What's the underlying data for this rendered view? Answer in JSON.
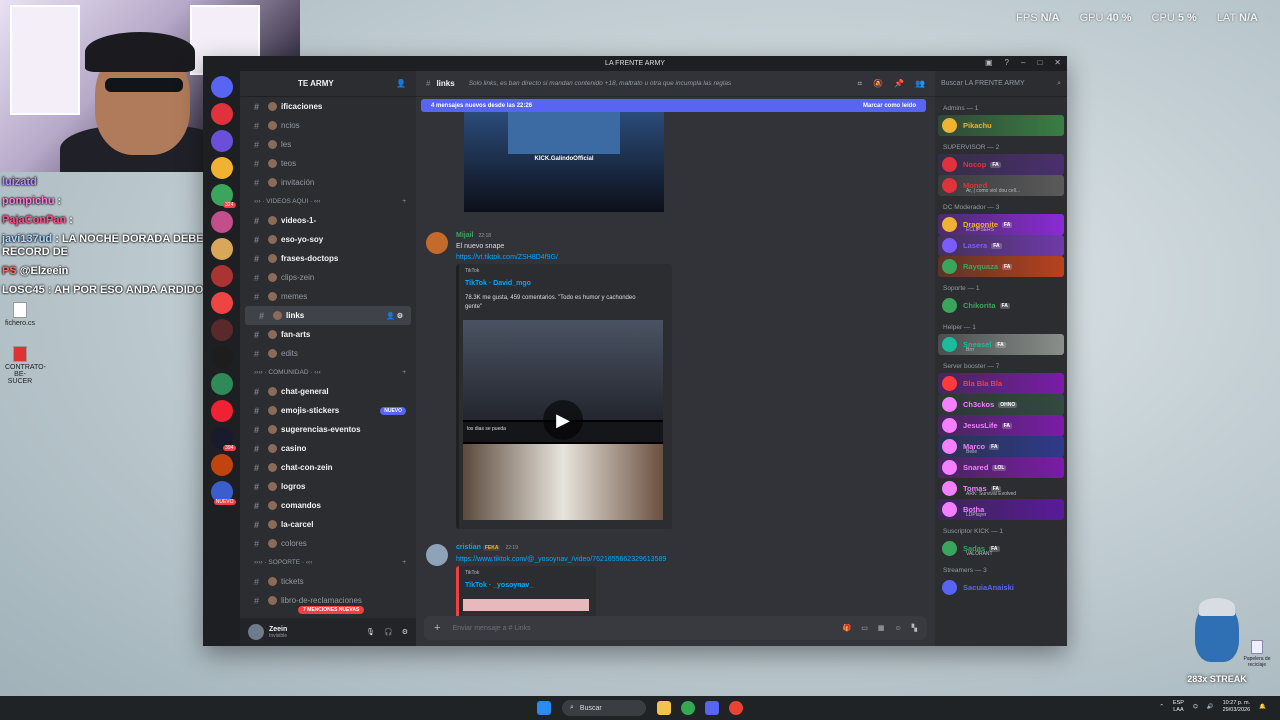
{
  "hud": {
    "fps_label": "FPS",
    "fps": "N/A",
    "gpu_label": "GPU",
    "gpu": "40 %",
    "cpu_label": "CPU",
    "cpu": "5 %",
    "lat_label": "LAT",
    "lat": "N/A"
  },
  "chat_overlay": [
    {
      "user": "luizatd",
      "text": ""
    },
    {
      "user": "pompichu",
      "text": ":"
    },
    {
      "user": "PajaConPan",
      "text": ":"
    },
    {
      "user": "javi137ud",
      "text": ": LA NOCHE DORADA DEBE ROMPER RECORD DE"
    },
    {
      "user": "PS",
      "text": "@Elzeein"
    },
    {
      "user": "LOSC45",
      "text": ": AH POR ESO ANDA ARDIDO XD"
    }
  ],
  "desktop_icons": [
    {
      "label": "fichero.cs",
      "type": "file"
    },
    {
      "label": "CONTRATO-BE-SUCER",
      "type": "pdf"
    }
  ],
  "window": {
    "title": "LA FRENTE ARMY",
    "server_name": "TE ARMY"
  },
  "guild_badges": [
    "324",
    "394"
  ],
  "guild_new": "NUEVO",
  "channels": [
    {
      "kind": "chan",
      "name": "ificaciones",
      "style": "bright"
    },
    {
      "kind": "chan",
      "name": "ncios"
    },
    {
      "kind": "chan",
      "name": "les"
    },
    {
      "kind": "chan",
      "name": "teos"
    },
    {
      "kind": "chan",
      "name": "invitación"
    },
    {
      "kind": "cat",
      "name": "››› · VIDEOS AQUI · ‹‹‹"
    },
    {
      "kind": "chan",
      "name": "videos-1-",
      "style": "bright"
    },
    {
      "kind": "chan",
      "name": "eso-yo-soy",
      "style": "bright"
    },
    {
      "kind": "chan",
      "name": "frases-doctops",
      "style": "bright"
    },
    {
      "kind": "chan",
      "name": "clips-zein"
    },
    {
      "kind": "chan",
      "name": "memes"
    },
    {
      "kind": "chan",
      "name": "links",
      "style": "sel"
    },
    {
      "kind": "chan",
      "name": "fan-arts",
      "style": "bright"
    },
    {
      "kind": "chan",
      "name": "edits"
    },
    {
      "kind": "cat",
      "name": "›››› · COMUNIDAD · ‹‹‹"
    },
    {
      "kind": "chan",
      "name": "chat-general",
      "style": "bright"
    },
    {
      "kind": "chan",
      "name": "emojis-stickers",
      "style": "bright",
      "badge": "NUEVO"
    },
    {
      "kind": "chan",
      "name": "sugerencias-eventos",
      "style": "bright"
    },
    {
      "kind": "chan",
      "name": "casino",
      "style": "bright"
    },
    {
      "kind": "chan",
      "name": "chat-con-zein",
      "style": "bright"
    },
    {
      "kind": "chan",
      "name": "logros",
      "style": "bright"
    },
    {
      "kind": "chan",
      "name": "comandos",
      "style": "bright"
    },
    {
      "kind": "chan",
      "name": "la-carcel",
      "style": "bright"
    },
    {
      "kind": "chan",
      "name": "colores"
    },
    {
      "kind": "cat",
      "name": "›››› · SOPORTE · ‹‹‹"
    },
    {
      "kind": "chan",
      "name": "tickets"
    },
    {
      "kind": "chan",
      "name": "libro-de-reclamaciones"
    }
  ],
  "mentions_pill": "7 MENCIONES NUEVAS",
  "user_panel": {
    "name": "Zeein",
    "status": "Invisible"
  },
  "header": {
    "channel": "links",
    "topic": "Solo links, es ban directo si mandan contenido +18, maltrato u otra que incumpla las reglas"
  },
  "new_messages": {
    "text": "4 mensajes nuevos desde las 22:26",
    "action": "Marcar como leído"
  },
  "messages": {
    "first_caption": "KICK.GalindoOfficial",
    "m1": {
      "author": "Mijail",
      "time": "22:18",
      "text": "El nuevo snape",
      "link": "https://vt.tiktok.com/ZSH8D4f9G/",
      "provider": "TikTok",
      "embed_title": "TikTok · David_mgo",
      "embed_desc_1": "78.3K me gusta, 459 comentarios. \"Todo es humor y cachondeo",
      "embed_desc_2": "gente\"",
      "video_caption": "los dias se pueda"
    },
    "m2": {
      "author": "cristian",
      "tag": "FEKA",
      "time": "22:19",
      "link": "https://www.tiktok.com/@_yosoynav_/video/7621655662329613589",
      "provider": "TikTok",
      "embed_title": "TikTok · _yosoynav_"
    }
  },
  "composer": {
    "placeholder": "Enviar mensaje a #",
    "channel": "Links"
  },
  "members": {
    "search": "Buscar LA FRENTE ARMY",
    "groups": [
      {
        "role": "Admins — 1",
        "list": [
          {
            "name": "Pikachu",
            "color": "#f0b232",
            "bg": "#3a7d44",
            "tag": ""
          }
        ]
      },
      {
        "role": "SUPERVISOR — 2",
        "list": [
          {
            "name": "Nocop",
            "color": "#e0323c",
            "bg": "#4a2f6e",
            "tag": "FA"
          },
          {
            "name": "Moned",
            "color": "#e0323c",
            "bg": "#5a5a5a",
            "tag": "",
            "status": "Ar, | como viol dou cell..."
          }
        ]
      },
      {
        "role": "DC Moderador — 3",
        "list": [
          {
            "name": "Dragonite",
            "color": "#f0b232",
            "bg": "#8a2bd6",
            "tag": "FA",
            "status": "ECLIPSERS"
          },
          {
            "name": "Lasera",
            "color": "#7c5cff",
            "bg": "#6f3aa8",
            "tag": "FA"
          },
          {
            "name": "Rayquaza",
            "color": "#3ba55d",
            "bg": "#b8421e",
            "tag": "FA"
          }
        ]
      },
      {
        "role": "Soporte — 1",
        "list": [
          {
            "name": "Chikorita",
            "color": "#3ba55d",
            "bg": "",
            "tag": "FA"
          }
        ]
      },
      {
        "role": "Helper — 1",
        "list": [
          {
            "name": "Sneasel",
            "color": "#1abc9c",
            "bg": "#8a8f8a",
            "tag": "FA",
            "status": "Brrr"
          }
        ]
      },
      {
        "role": "Server booster — 7",
        "list": [
          {
            "name": "Bla Bla Bla",
            "color": "#ff3b3b",
            "bg": "#7a1ca8",
            "tag": ""
          },
          {
            "name": "Ch3ckos",
            "color": "#f47fff",
            "bg": "#334a40",
            "tag": "OHNO"
          },
          {
            "name": "JesusLife",
            "color": "#f47fff",
            "bg": "#7a1ca8",
            "tag": "FA"
          },
          {
            "name": "Marco",
            "color": "#f47fff",
            "bg": "#2f3a8a",
            "tag": "FA",
            "status": "Belle"
          },
          {
            "name": "Snared",
            "color": "#f47fff",
            "bg": "#7a1ca8",
            "tag": "LOL"
          },
          {
            "name": "Tomas",
            "color": "#f47fff",
            "bg": "#2b2d31",
            "tag": "FA",
            "status": "ARK: Survival Evolved"
          },
          {
            "name": "Botha",
            "color": "#f47fff",
            "bg": "#5a1a9a",
            "tag": "",
            "status": "LDPlayer"
          }
        ]
      },
      {
        "role": "Suscriptor KICK — 1",
        "list": [
          {
            "name": "Sadas",
            "color": "#3ba55d",
            "bg": "",
            "tag": "FA",
            "status": "VALORANT"
          }
        ]
      },
      {
        "role": "Streamers — 3",
        "list": [
          {
            "name": "SacuiaAnaiski",
            "color": "#5865f2",
            "bg": "",
            "tag": ""
          }
        ]
      }
    ]
  },
  "taskbar": {
    "search": "Buscar",
    "lang": "ESP",
    "region": "LAA",
    "time": "10:27 p. m.",
    "date": "29/03/2026"
  },
  "streak": "283x STREAK",
  "recycle": "Papelera de reciclaje"
}
